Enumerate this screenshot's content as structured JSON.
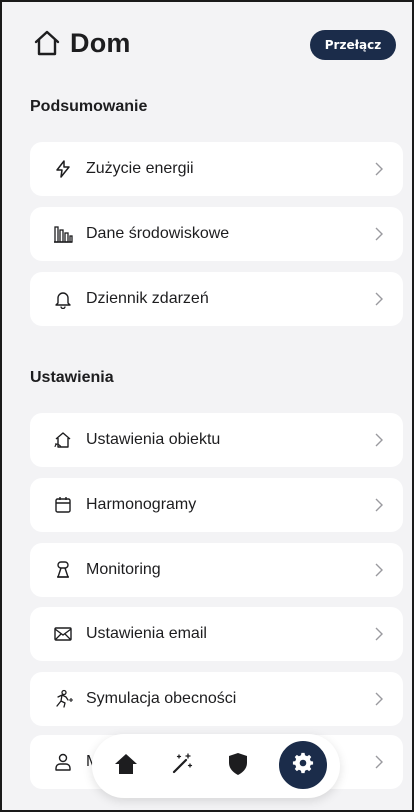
{
  "header": {
    "title": "Dom",
    "switch_label": "Przełącz"
  },
  "summary": {
    "title": "Podsumowanie",
    "items": [
      {
        "label": "Zużycie energii",
        "icon": "lightning-icon"
      },
      {
        "label": "Dane środowiskowe",
        "icon": "bar-chart-icon"
      },
      {
        "label": "Dziennik zdarzeń",
        "icon": "bell-icon"
      }
    ]
  },
  "settings": {
    "title": "Ustawienia",
    "items": [
      {
        "label": "Ustawienia obiektu",
        "icon": "home-settings-icon"
      },
      {
        "label": "Harmonogramy",
        "icon": "calendar-icon"
      },
      {
        "label": "Monitoring",
        "icon": "monitoring-icon"
      },
      {
        "label": "Ustawienia email",
        "icon": "mail-icon"
      },
      {
        "label": "Symulacja obecności",
        "icon": "running-person-icon"
      },
      {
        "label": "Mó",
        "icon": "user-icon"
      }
    ]
  },
  "bottom_nav": {
    "items": [
      {
        "name": "home",
        "icon": "home-filled-icon"
      },
      {
        "name": "scenes",
        "icon": "magic-wand-icon"
      },
      {
        "name": "security",
        "icon": "shield-icon"
      },
      {
        "name": "settings",
        "icon": "gear-icon",
        "active": true
      }
    ]
  },
  "colors": {
    "background": "#f3f3f5",
    "card": "#ffffff",
    "accent": "#1b2c4a",
    "text": "#1d1d1f",
    "chevron": "#9a9a9f"
  }
}
